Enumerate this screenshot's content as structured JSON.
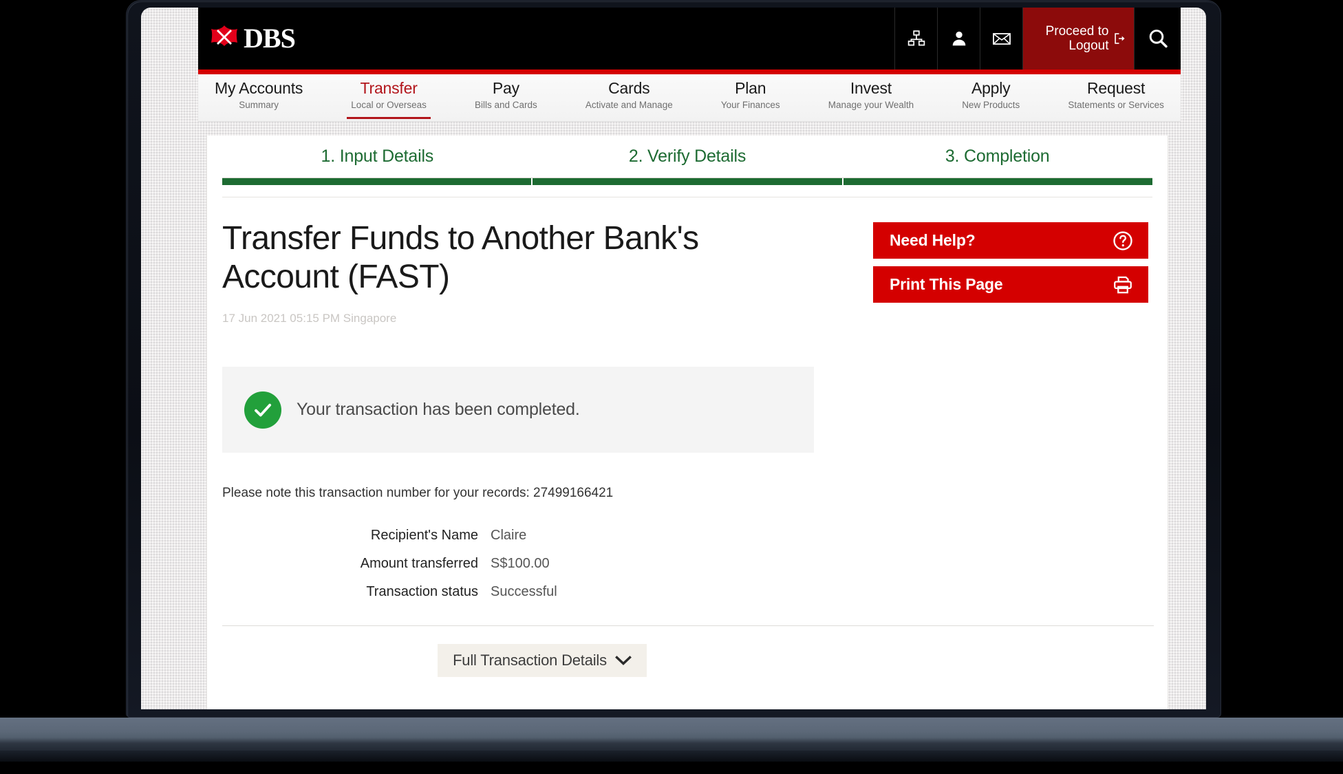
{
  "header": {
    "brand": "DBS",
    "logo_icon": "dbs-diamond-logo",
    "icons": [
      {
        "name": "sitemap-icon",
        "label": "Sitemap"
      },
      {
        "name": "person-icon",
        "label": "Profile"
      },
      {
        "name": "envelope-icon",
        "label": "Messages"
      }
    ],
    "logout_label": "Proceed to Logout",
    "logout_icon": "logout-arrow-icon",
    "search_icon": "search-icon",
    "logout_bg": "#8c0b0b",
    "bar_bg": "#000000",
    "stripe_color": "#d40000"
  },
  "nav": {
    "active_color": "#b2151b",
    "items": [
      {
        "title": "My Accounts",
        "sub": "Summary",
        "active": false
      },
      {
        "title": "Transfer",
        "sub": "Local or Overseas",
        "active": true
      },
      {
        "title": "Pay",
        "sub": "Bills and Cards",
        "active": false
      },
      {
        "title": "Cards",
        "sub": "Activate and Manage",
        "active": false
      },
      {
        "title": "Plan",
        "sub": "Your Finances",
        "active": false
      },
      {
        "title": "Invest",
        "sub": "Manage your Wealth",
        "active": false
      },
      {
        "title": "Apply",
        "sub": "New Products",
        "active": false
      },
      {
        "title": "Request",
        "sub": "Statements or Services",
        "active": false
      }
    ]
  },
  "steps": {
    "color": "#1d6b32",
    "items": [
      {
        "label": "1. Input Details"
      },
      {
        "label": "2. Verify Details"
      },
      {
        "label": "3. Completion"
      }
    ]
  },
  "main": {
    "title": "Transfer Funds to Another Bank's Account (FAST)",
    "timestamp": "17 Jun 2021 05:15 PM Singapore",
    "alert": {
      "icon": "check-circle-icon",
      "icon_color": "#22a03b",
      "message": "Your transaction has been completed."
    },
    "transaction_note": "Please note this transaction number for your records: 27499166421",
    "transaction_number": "27499166421",
    "details": [
      {
        "label": "Recipient's Name",
        "value": "Claire"
      },
      {
        "label": "Amount transferred",
        "value": "S$100.00"
      },
      {
        "label": "Transaction status",
        "value": "Successful"
      }
    ],
    "full_details_label": "Full Transaction Details",
    "full_details_icon": "chevron-down-icon"
  },
  "sidebar": {
    "buttons": [
      {
        "label": "Need Help?",
        "icon": "question-circle-icon"
      },
      {
        "label": "Print This Page",
        "icon": "printer-icon"
      }
    ],
    "button_bg": "#d40000"
  }
}
